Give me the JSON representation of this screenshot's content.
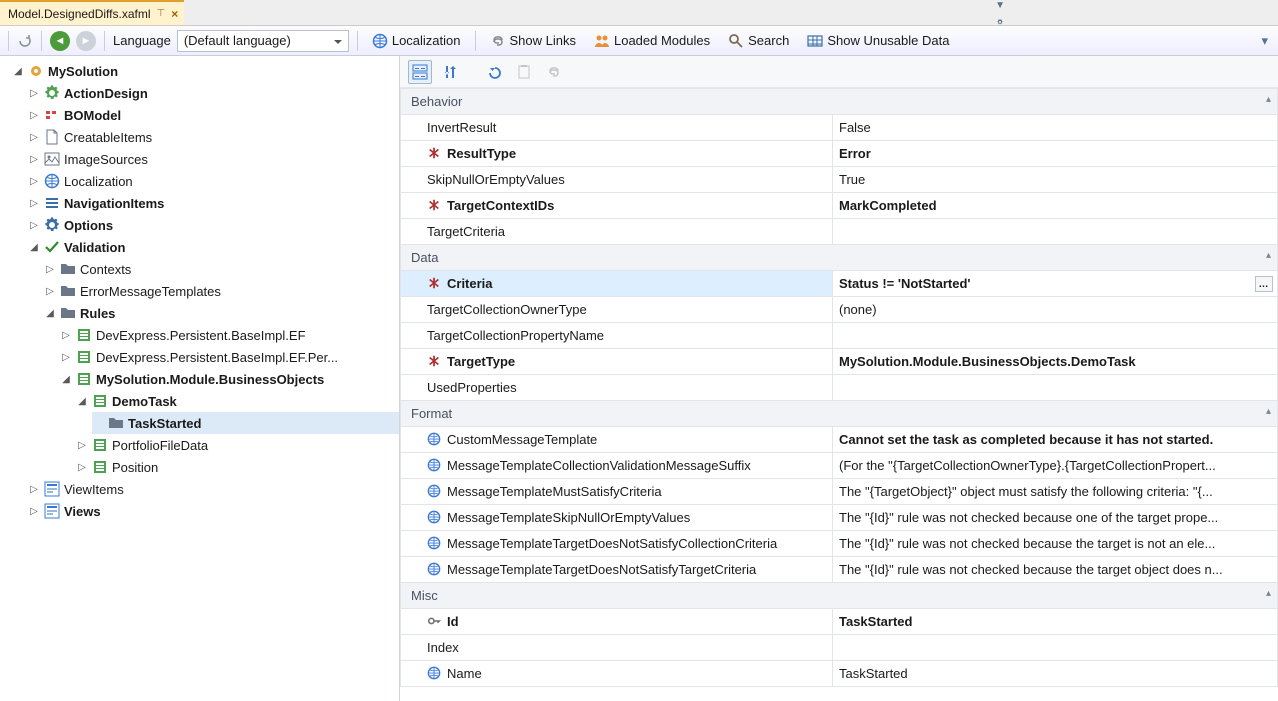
{
  "tab": {
    "title": "Model.DesignedDiffs.xafml"
  },
  "toolbar": {
    "language_label": "Language",
    "language_value": "(Default language)",
    "localization": "Localization",
    "show_links": "Show Links",
    "loaded_modules": "Loaded Modules",
    "search": "Search",
    "show_unusable": "Show Unusable Data"
  },
  "tree": {
    "root": "MySolution",
    "action_design": "ActionDesign",
    "bomodel": "BOModel",
    "creatable_items": "CreatableItems",
    "image_sources": "ImageSources",
    "localization": "Localization",
    "navigation_items": "NavigationItems",
    "options": "Options",
    "validation": "Validation",
    "contexts": "Contexts",
    "error_templates": "ErrorMessageTemplates",
    "rules": "Rules",
    "rule1": "DevExpress.Persistent.BaseImpl.EF",
    "rule2": "DevExpress.Persistent.BaseImpl.EF.Per...",
    "rule3": "MySolution.Module.BusinessObjects",
    "demotask": "DemoTask",
    "taskstarted": "TaskStarted",
    "portfolio": "PortfolioFileData",
    "position": "Position",
    "viewitems": "ViewItems",
    "views": "Views"
  },
  "grid": {
    "cat_behavior": "Behavior",
    "cat_data": "Data",
    "cat_format": "Format",
    "cat_misc": "Misc",
    "p": {
      "InvertResult": {
        "n": "InvertResult",
        "v": "False"
      },
      "ResultType": {
        "n": "ResultType",
        "v": "Error"
      },
      "SkipNull": {
        "n": "SkipNullOrEmptyValues",
        "v": "True"
      },
      "TargetCtx": {
        "n": "TargetContextIDs",
        "v": "MarkCompleted"
      },
      "TargetCrit": {
        "n": "TargetCriteria",
        "v": ""
      },
      "Criteria": {
        "n": "Criteria",
        "v": "Status != 'NotStarted'"
      },
      "TColOwner": {
        "n": "TargetCollectionOwnerType",
        "v": "(none)"
      },
      "TColProp": {
        "n": "TargetCollectionPropertyName",
        "v": ""
      },
      "TargetType": {
        "n": "TargetType",
        "v": "MySolution.Module.BusinessObjects.DemoTask"
      },
      "UsedProps": {
        "n": "UsedProperties",
        "v": ""
      },
      "CustomMsg": {
        "n": "CustomMessageTemplate",
        "v": "Cannot set the task as completed because it has not started."
      },
      "MColSuffix": {
        "n": "MessageTemplateCollectionValidationMessageSuffix",
        "v": "(For the \"{TargetCollectionOwnerType}.{TargetCollectionPropert..."
      },
      "MSatisfy": {
        "n": "MessageTemplateMustSatisfyCriteria",
        "v": "The \"{TargetObject}\" object must satisfy the following criteria: \"{..."
      },
      "MSkip": {
        "n": "MessageTemplateSkipNullOrEmptyValues",
        "v": "The \"{Id}\" rule was not checked because one of the target prope..."
      },
      "MNoCol": {
        "n": "MessageTemplateTargetDoesNotSatisfyCollectionCriteria",
        "v": "The \"{Id}\" rule was not checked because the target is not an ele..."
      },
      "MNoTarget": {
        "n": "MessageTemplateTargetDoesNotSatisfyTargetCriteria",
        "v": "The \"{Id}\" rule was not checked because the target object does n..."
      },
      "Id": {
        "n": "Id",
        "v": "TaskStarted"
      },
      "Index": {
        "n": "Index",
        "v": ""
      },
      "Name": {
        "n": "Name",
        "v": "TaskStarted"
      }
    }
  }
}
